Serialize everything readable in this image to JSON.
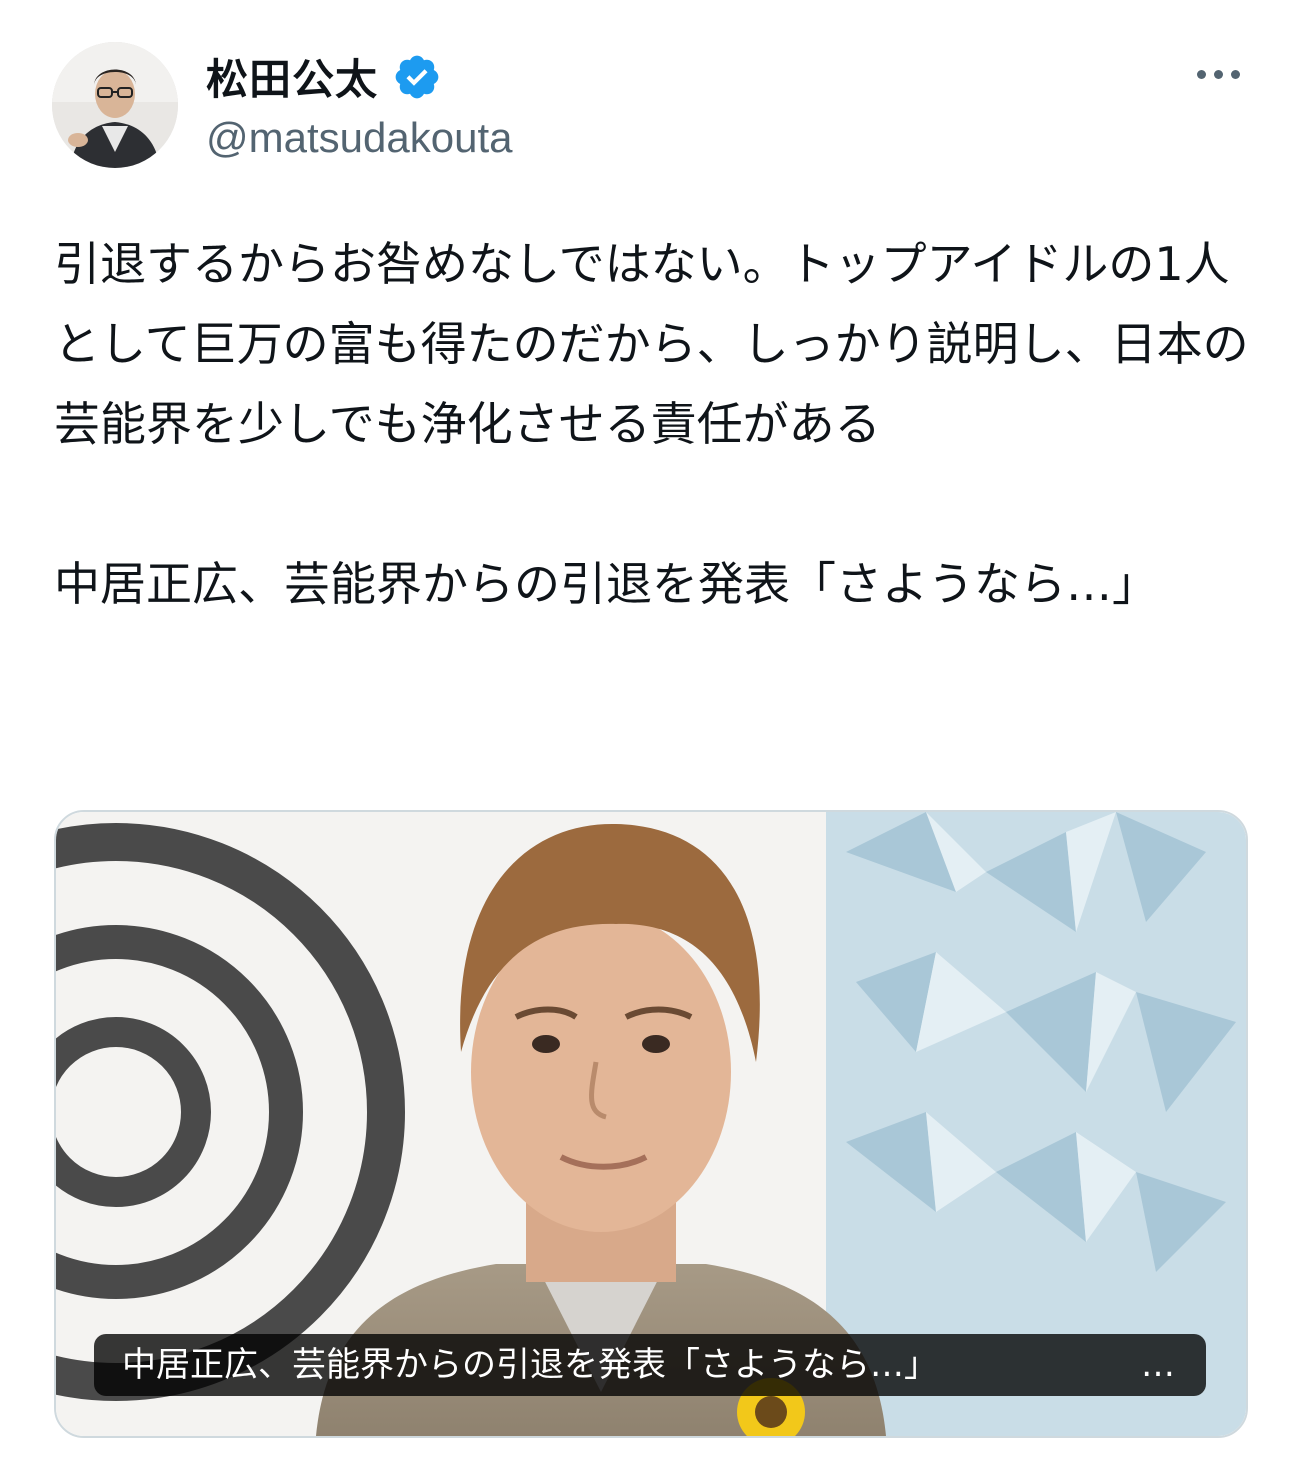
{
  "author": {
    "display_name": "松田公太",
    "handle": "@matsudakouta",
    "verified": true
  },
  "icons": {
    "verified": "verified-badge-icon",
    "more": "more-horizontal-icon"
  },
  "colors": {
    "verified_blue": "#1d9bf0",
    "text_primary": "#0f1419",
    "text_secondary": "#536471",
    "card_border": "#cfd9de"
  },
  "tweet": {
    "body": "引退するからお咎めなしではない。トップアイドルの1人として巨万の富も得たのだから、しっかり説明し、日本の芸能界を少しでも浄化させる責任がある",
    "link_title": "中居正広、芸能界からの引退を発表「さようなら…」"
  },
  "card": {
    "caption": "中居正広、芸能界からの引退を発表「さようなら…」",
    "caption_ellipsis": "…"
  }
}
